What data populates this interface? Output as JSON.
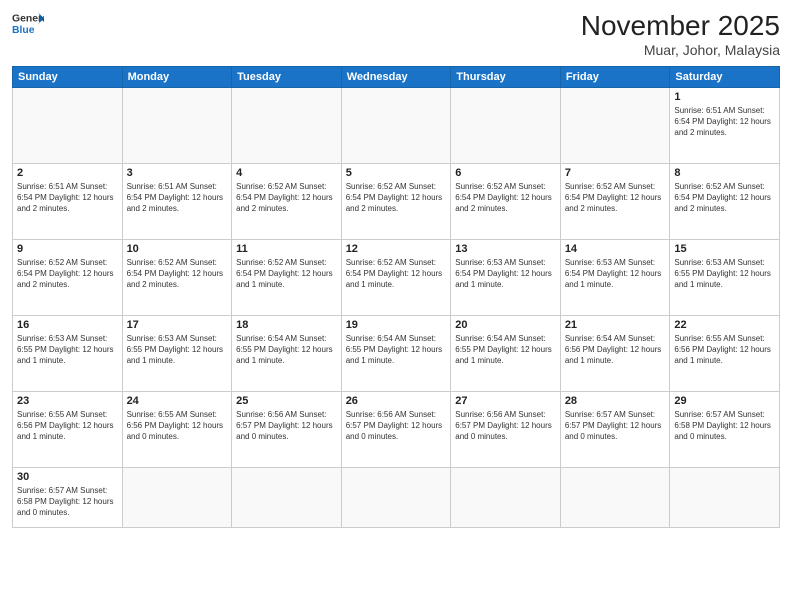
{
  "header": {
    "logo_general": "General",
    "logo_blue": "Blue",
    "month_title": "November 2025",
    "location": "Muar, Johor, Malaysia"
  },
  "weekdays": [
    "Sunday",
    "Monday",
    "Tuesday",
    "Wednesday",
    "Thursday",
    "Friday",
    "Saturday"
  ],
  "weeks": [
    [
      {
        "day": "",
        "info": ""
      },
      {
        "day": "",
        "info": ""
      },
      {
        "day": "",
        "info": ""
      },
      {
        "day": "",
        "info": ""
      },
      {
        "day": "",
        "info": ""
      },
      {
        "day": "",
        "info": ""
      },
      {
        "day": "1",
        "info": "Sunrise: 6:51 AM\nSunset: 6:54 PM\nDaylight: 12 hours and 2 minutes."
      }
    ],
    [
      {
        "day": "2",
        "info": "Sunrise: 6:51 AM\nSunset: 6:54 PM\nDaylight: 12 hours and 2 minutes."
      },
      {
        "day": "3",
        "info": "Sunrise: 6:51 AM\nSunset: 6:54 PM\nDaylight: 12 hours and 2 minutes."
      },
      {
        "day": "4",
        "info": "Sunrise: 6:52 AM\nSunset: 6:54 PM\nDaylight: 12 hours and 2 minutes."
      },
      {
        "day": "5",
        "info": "Sunrise: 6:52 AM\nSunset: 6:54 PM\nDaylight: 12 hours and 2 minutes."
      },
      {
        "day": "6",
        "info": "Sunrise: 6:52 AM\nSunset: 6:54 PM\nDaylight: 12 hours and 2 minutes."
      },
      {
        "day": "7",
        "info": "Sunrise: 6:52 AM\nSunset: 6:54 PM\nDaylight: 12 hours and 2 minutes."
      },
      {
        "day": "8",
        "info": "Sunrise: 6:52 AM\nSunset: 6:54 PM\nDaylight: 12 hours and 2 minutes."
      }
    ],
    [
      {
        "day": "9",
        "info": "Sunrise: 6:52 AM\nSunset: 6:54 PM\nDaylight: 12 hours and 2 minutes."
      },
      {
        "day": "10",
        "info": "Sunrise: 6:52 AM\nSunset: 6:54 PM\nDaylight: 12 hours and 2 minutes."
      },
      {
        "day": "11",
        "info": "Sunrise: 6:52 AM\nSunset: 6:54 PM\nDaylight: 12 hours and 1 minute."
      },
      {
        "day": "12",
        "info": "Sunrise: 6:52 AM\nSunset: 6:54 PM\nDaylight: 12 hours and 1 minute."
      },
      {
        "day": "13",
        "info": "Sunrise: 6:53 AM\nSunset: 6:54 PM\nDaylight: 12 hours and 1 minute."
      },
      {
        "day": "14",
        "info": "Sunrise: 6:53 AM\nSunset: 6:54 PM\nDaylight: 12 hours and 1 minute."
      },
      {
        "day": "15",
        "info": "Sunrise: 6:53 AM\nSunset: 6:55 PM\nDaylight: 12 hours and 1 minute."
      }
    ],
    [
      {
        "day": "16",
        "info": "Sunrise: 6:53 AM\nSunset: 6:55 PM\nDaylight: 12 hours and 1 minute."
      },
      {
        "day": "17",
        "info": "Sunrise: 6:53 AM\nSunset: 6:55 PM\nDaylight: 12 hours and 1 minute."
      },
      {
        "day": "18",
        "info": "Sunrise: 6:54 AM\nSunset: 6:55 PM\nDaylight: 12 hours and 1 minute."
      },
      {
        "day": "19",
        "info": "Sunrise: 6:54 AM\nSunset: 6:55 PM\nDaylight: 12 hours and 1 minute."
      },
      {
        "day": "20",
        "info": "Sunrise: 6:54 AM\nSunset: 6:55 PM\nDaylight: 12 hours and 1 minute."
      },
      {
        "day": "21",
        "info": "Sunrise: 6:54 AM\nSunset: 6:56 PM\nDaylight: 12 hours and 1 minute."
      },
      {
        "day": "22",
        "info": "Sunrise: 6:55 AM\nSunset: 6:56 PM\nDaylight: 12 hours and 1 minute."
      }
    ],
    [
      {
        "day": "23",
        "info": "Sunrise: 6:55 AM\nSunset: 6:56 PM\nDaylight: 12 hours and 1 minute."
      },
      {
        "day": "24",
        "info": "Sunrise: 6:55 AM\nSunset: 6:56 PM\nDaylight: 12 hours and 0 minutes."
      },
      {
        "day": "25",
        "info": "Sunrise: 6:56 AM\nSunset: 6:57 PM\nDaylight: 12 hours and 0 minutes."
      },
      {
        "day": "26",
        "info": "Sunrise: 6:56 AM\nSunset: 6:57 PM\nDaylight: 12 hours and 0 minutes."
      },
      {
        "day": "27",
        "info": "Sunrise: 6:56 AM\nSunset: 6:57 PM\nDaylight: 12 hours and 0 minutes."
      },
      {
        "day": "28",
        "info": "Sunrise: 6:57 AM\nSunset: 6:57 PM\nDaylight: 12 hours and 0 minutes."
      },
      {
        "day": "29",
        "info": "Sunrise: 6:57 AM\nSunset: 6:58 PM\nDaylight: 12 hours and 0 minutes."
      }
    ],
    [
      {
        "day": "30",
        "info": "Sunrise: 6:57 AM\nSunset: 6:58 PM\nDaylight: 12 hours and 0 minutes."
      },
      {
        "day": "",
        "info": ""
      },
      {
        "day": "",
        "info": ""
      },
      {
        "day": "",
        "info": ""
      },
      {
        "day": "",
        "info": ""
      },
      {
        "day": "",
        "info": ""
      },
      {
        "day": "",
        "info": ""
      }
    ]
  ]
}
